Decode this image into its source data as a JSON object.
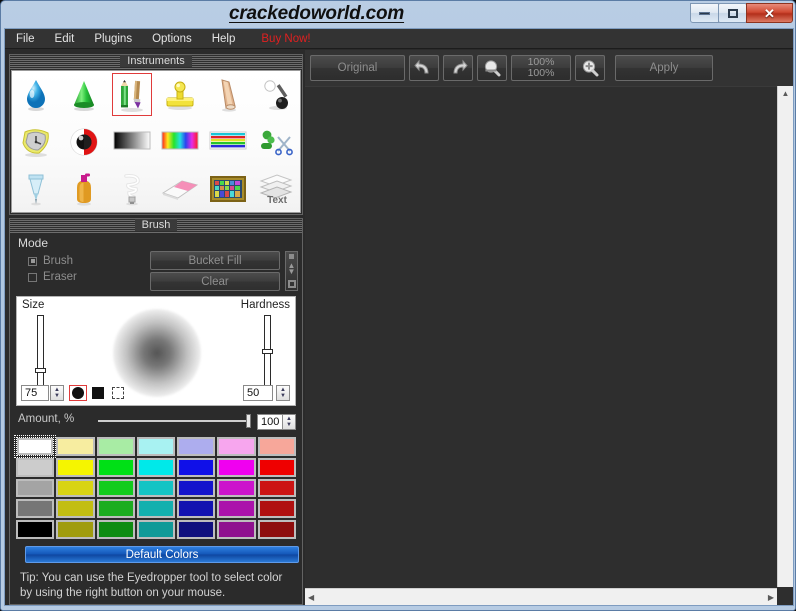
{
  "window": {
    "title": "crackedoworld.com",
    "controls": {
      "minimize": "minimize-button",
      "maximize": "maximize-button",
      "close": "✕"
    }
  },
  "menu": {
    "items": [
      {
        "label": "File"
      },
      {
        "label": "Edit"
      },
      {
        "label": "Plugins"
      },
      {
        "label": "Options"
      },
      {
        "label": "Help"
      },
      {
        "label": "Buy Now!",
        "color": "#e02020"
      }
    ]
  },
  "instruments": {
    "title": "Instruments",
    "selected_index": 2,
    "items": [
      {
        "name": "water-drop-tool"
      },
      {
        "name": "cone-tool"
      },
      {
        "name": "pencil-brush-tool"
      },
      {
        "name": "stamp-tool"
      },
      {
        "name": "smudge-tool"
      },
      {
        "name": "dodge-burn-tool"
      },
      {
        "name": "distort-clock-tool"
      },
      {
        "name": "invert-sphere-tool"
      },
      {
        "name": "gradient-tool"
      },
      {
        "name": "spectrum-tool"
      },
      {
        "name": "color-stripes-tool"
      },
      {
        "name": "scissors-tool"
      },
      {
        "name": "syringe-tool"
      },
      {
        "name": "bottle-tool"
      },
      {
        "name": "bulb-tool"
      },
      {
        "name": "eraser-tool"
      },
      {
        "name": "picture-frame-tool"
      },
      {
        "name": "layers-text-tool"
      }
    ]
  },
  "brush": {
    "title": "Brush",
    "mode_label": "Mode",
    "modes": [
      {
        "label": "Brush",
        "selected": true
      },
      {
        "label": "Eraser",
        "selected": false
      }
    ],
    "bucket_fill_label": "Bucket Fill",
    "clear_label": "Clear",
    "size_label": "Size",
    "size_value": "75",
    "hardness_label": "Hardness",
    "hardness_value": "50",
    "amount_label": "Amount, %",
    "amount_value": "100",
    "shapes": [
      {
        "name": "round",
        "selected": true
      },
      {
        "name": "square",
        "selected": false
      },
      {
        "name": "dashed",
        "selected": false
      }
    ]
  },
  "palette": {
    "default_colors_label": "Default Colors",
    "selected_index": 0,
    "rows": [
      [
        "#ffffff",
        "#f7eda0",
        "#a8eca4",
        "#a8f2f2",
        "#adadee",
        "#f7a6ee",
        "#f7a79a"
      ],
      [
        "#cccccc",
        "#f5f500",
        "#00e016",
        "#00e9e9",
        "#1010e8",
        "#f000f0",
        "#ef0000"
      ],
      [
        "#a4a4a4",
        "#d8d414",
        "#12cc1d",
        "#14c4c4",
        "#1414cc",
        "#cc14cc",
        "#cc1414"
      ],
      [
        "#767676",
        "#c2be12",
        "#1cad20",
        "#13b0ae",
        "#1212b0",
        "#ab12ab",
        "#b01010"
      ],
      [
        "#000000",
        "#a09c0e",
        "#0e8c12",
        "#0f9a98",
        "#10107e",
        "#8f118f",
        "#8e0d0d"
      ]
    ]
  },
  "tip": {
    "text": "Tip: You can use the Eyedropper tool to select color by using the right button on your mouse."
  },
  "toolbar": {
    "original_label": "Original",
    "undo_label": "undo-icon",
    "redo_label": "redo-icon",
    "zoom_out_label": "zoom-out-icon",
    "zoom_in_label": "zoom-in-icon",
    "zoom_value_top": "100%",
    "zoom_value_bottom": "100%",
    "apply_label": "Apply"
  },
  "scrollbars": {
    "left_arrow": "◀",
    "right_arrow": "▶",
    "up_arrow": "▲"
  }
}
